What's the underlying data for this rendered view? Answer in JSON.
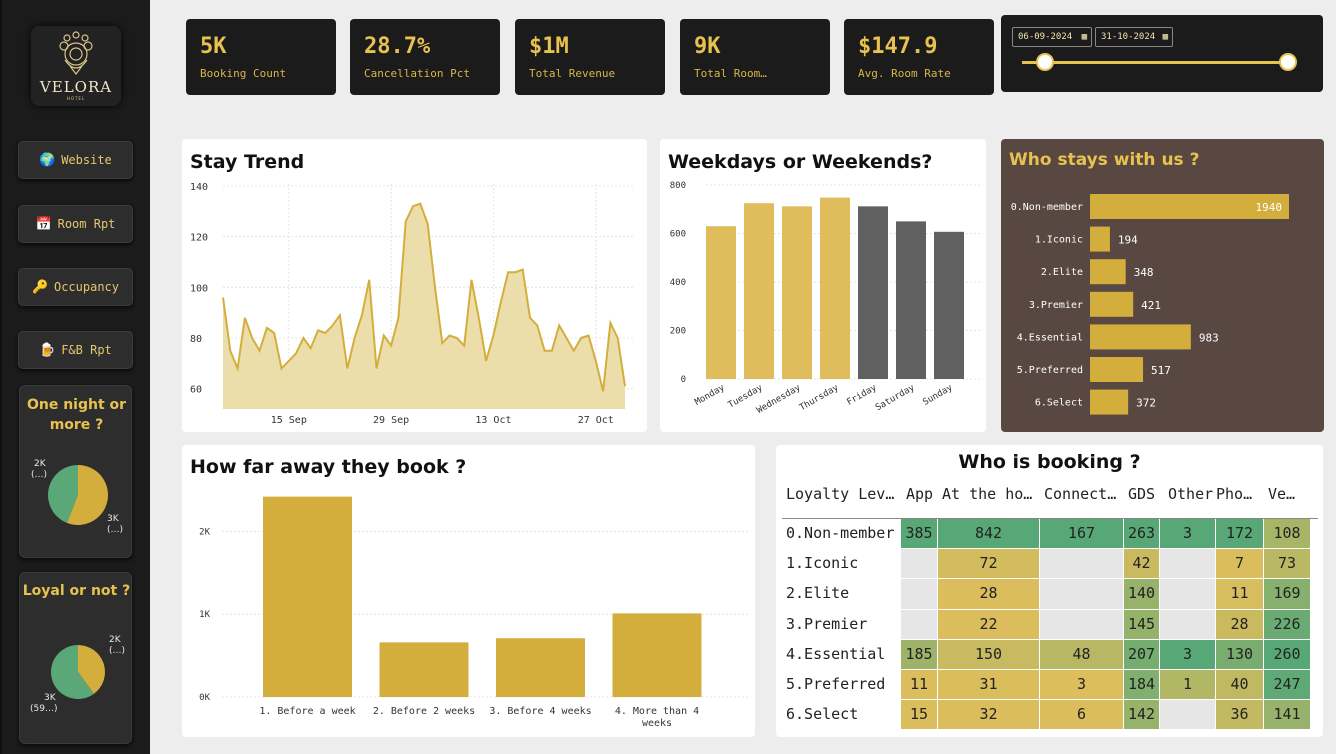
{
  "sidebar": {
    "logo": {
      "brand": "VELORA",
      "sub": "HOTEL"
    },
    "nav": [
      {
        "label": "Website",
        "icon": "globe-icon",
        "glyph": "🌍"
      },
      {
        "label": "Room Rpt",
        "icon": "calendar-icon",
        "glyph": "📅"
      },
      {
        "label": "Occupancy",
        "icon": "key-icon",
        "glyph": "🔑"
      },
      {
        "label": "F&B Rpt",
        "icon": "beer-icon",
        "glyph": "🍺"
      }
    ],
    "one_night": {
      "title": "One night or more ?",
      "slices": [
        {
          "label": "2K",
          "sub": "(…)",
          "color": "#5aa877",
          "share": 0.44
        },
        {
          "label": "3K",
          "sub": "(…)",
          "color": "#d4ae3c",
          "share": 0.56
        }
      ]
    },
    "loyal": {
      "title": "Loyal or not ?",
      "slices": [
        {
          "label": "2K",
          "sub": "(…)",
          "color": "#d4ae3c",
          "share": 0.4
        },
        {
          "label": "3K",
          "sub": "(59…)",
          "color": "#5aa877",
          "share": 0.6
        }
      ]
    }
  },
  "kpis": [
    {
      "value": "5K",
      "label": "Booking Count"
    },
    {
      "value": "28.7%",
      "label": "Cancellation Pct"
    },
    {
      "value": "$1M",
      "label": "Total Revenue"
    },
    {
      "value": "9K",
      "label": "Total Room…"
    },
    {
      "value": "$147.9",
      "label": "Avg. Room Rate"
    }
  ],
  "date_range": {
    "start": "06-09-2024",
    "end": "31-10-2024"
  },
  "stay_trend": {
    "title": "Stay Trend",
    "chart_data": {
      "type": "area",
      "ylim": [
        52,
        140
      ],
      "yticks": [
        60,
        80,
        100,
        120,
        140
      ],
      "xticks": [
        {
          "label": "15 Sep",
          "day": 9
        },
        {
          "label": "29 Sep",
          "day": 23
        },
        {
          "label": "13 Oct",
          "day": 37
        },
        {
          "label": "27 Oct",
          "day": 51
        }
      ],
      "values": [
        96,
        75,
        68,
        88,
        80,
        75,
        84,
        82,
        68,
        71,
        74,
        80,
        76,
        83,
        82,
        85,
        89,
        68,
        80,
        89,
        103,
        68,
        81,
        77,
        88,
        126,
        132,
        133,
        125,
        100,
        78,
        81,
        80,
        77,
        103,
        88,
        71,
        81,
        94,
        106,
        106,
        107,
        88,
        85,
        75,
        75,
        85,
        80,
        75,
        80,
        81,
        71,
        59,
        86,
        80,
        61
      ],
      "color": "#d4ae3c",
      "fill": "#ecdeaa"
    }
  },
  "weekdays": {
    "title": "Weekdays or Weekends?",
    "chart_data": {
      "type": "bar",
      "categories": [
        "Monday",
        "Tuesday",
        "Wednesday",
        "Thursday",
        "Friday",
        "Saturday",
        "Sunday"
      ],
      "values": [
        630,
        725,
        712,
        748,
        712,
        650,
        607
      ],
      "colors": [
        "#dfbc5c",
        "#dfbc5c",
        "#dfbc5c",
        "#dfbc5c",
        "#606060",
        "#606060",
        "#606060"
      ],
      "ylim": [
        0,
        800
      ],
      "yticks": [
        0,
        200,
        400,
        600,
        800
      ]
    }
  },
  "who_stays": {
    "title": "Who stays with us ?",
    "chart_data": {
      "type": "bar",
      "categories": [
        "0.Non-member",
        "1.Iconic",
        "2.Elite",
        "3.Premier",
        "4.Essential",
        "5.Preferred",
        "6.Select"
      ],
      "values": [
        1940,
        194,
        348,
        421,
        983,
        517,
        372
      ],
      "xlim": [
        0,
        1940
      ],
      "color": "#d4ae3c"
    }
  },
  "how_far": {
    "title": "How far away they book ?",
    "chart_data": {
      "type": "bar",
      "categories": [
        "1. Before a week",
        "2. Before 2 weeks",
        "3. Before 4 weeks",
        "4. More than 4 weeks"
      ],
      "values": [
        2420,
        660,
        710,
        1010
      ],
      "ylim": [
        0,
        2500
      ],
      "yticks": [
        {
          "v": 0,
          "label": "0K"
        },
        {
          "v": 1000,
          "label": "1K"
        },
        {
          "v": 2000,
          "label": "2K"
        }
      ],
      "color": "#d4ae3c"
    }
  },
  "matrix": {
    "title": "Who is booking ?",
    "columns": [
      "Loyalty Lev…",
      "App",
      "At the ho…",
      "Connect…",
      "GDS",
      "Other",
      "Pho…",
      "Ve…"
    ],
    "rows": [
      {
        "label": "0.Non-member",
        "cells": [
          385,
          842,
          167,
          263,
          3,
          172,
          108
        ]
      },
      {
        "label": "1.Iconic",
        "cells": [
          null,
          72,
          null,
          42,
          null,
          7,
          73
        ]
      },
      {
        "label": "2.Elite",
        "cells": [
          null,
          28,
          null,
          140,
          null,
          11,
          169
        ]
      },
      {
        "label": "3.Premier",
        "cells": [
          null,
          22,
          null,
          145,
          null,
          28,
          226
        ]
      },
      {
        "label": "4.Essential",
        "cells": [
          185,
          150,
          48,
          207,
          3,
          130,
          260
        ]
      },
      {
        "label": "5.Preferred",
        "cells": [
          11,
          31,
          3,
          184,
          1,
          40,
          247
        ]
      },
      {
        "label": "6.Select",
        "cells": [
          15,
          32,
          6,
          142,
          null,
          36,
          141
        ]
      }
    ]
  }
}
